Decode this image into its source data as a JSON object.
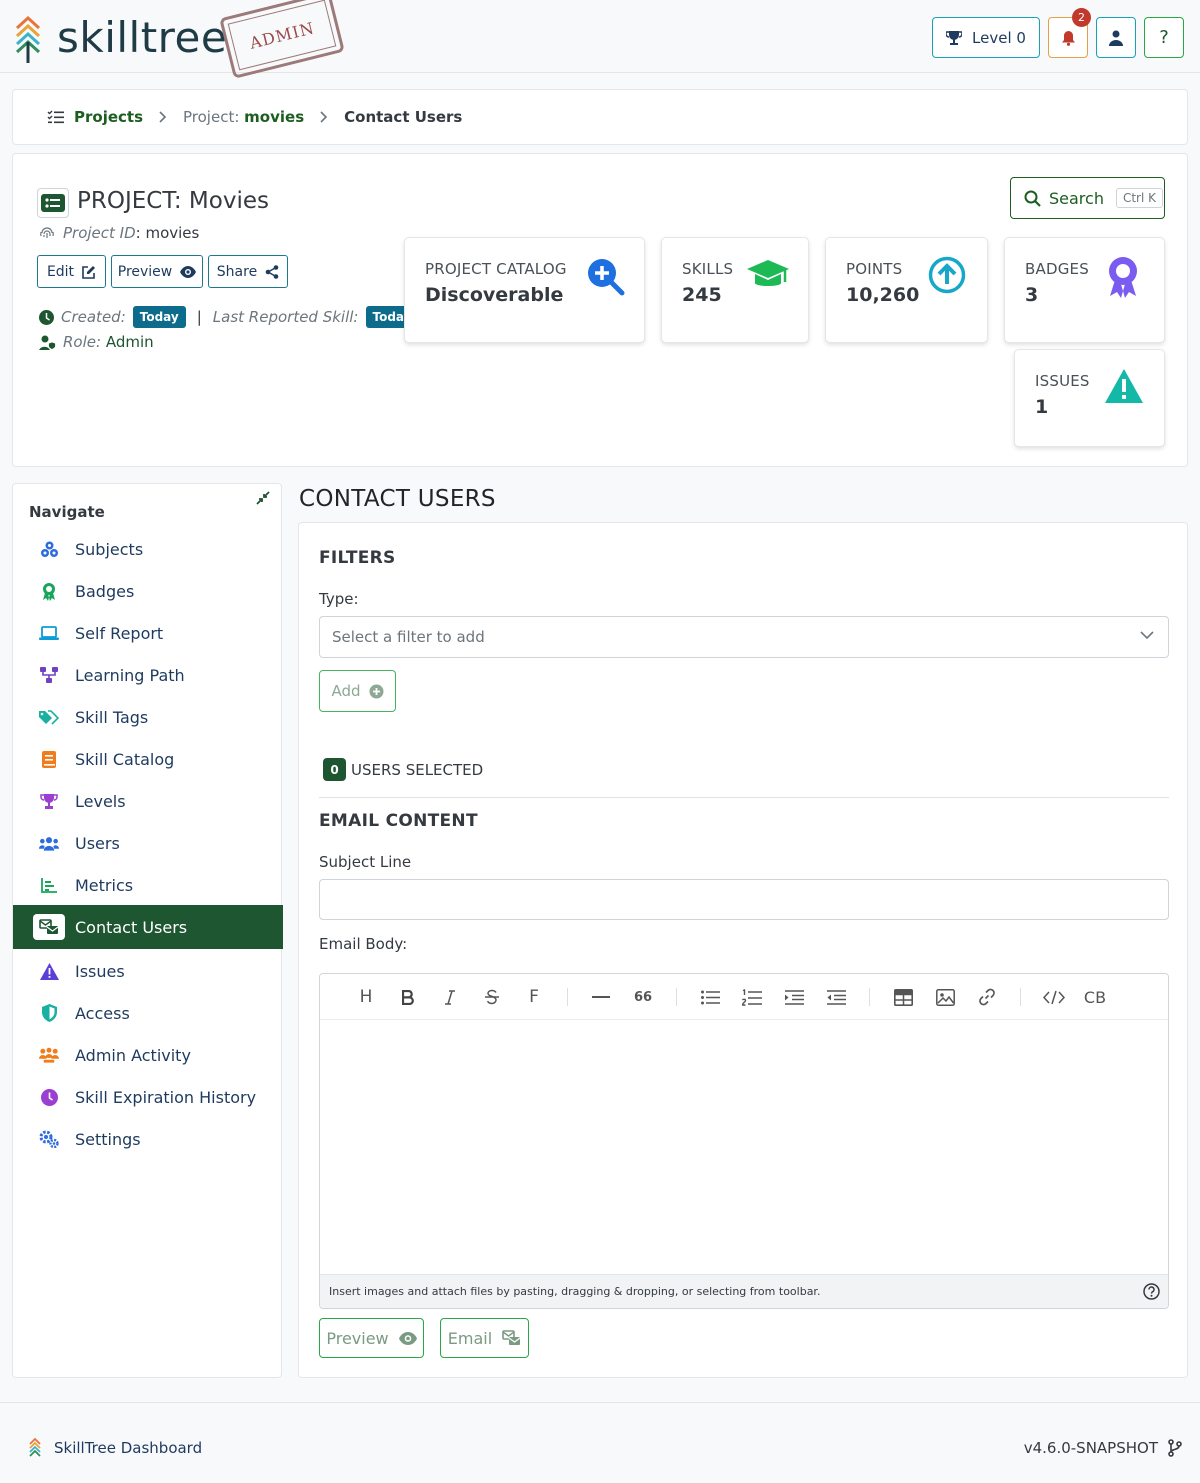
{
  "app": {
    "brand": "skilltree",
    "stamp": "ADMIN"
  },
  "topbar": {
    "level_label": "Level 0",
    "notification_count": "2",
    "help_label": "?"
  },
  "breadcrumb": {
    "projects": "Projects",
    "project_prefix": "Project:",
    "project_name": "movies",
    "current": "Contact Users"
  },
  "project": {
    "title": "PROJECT: Movies",
    "id_label": "Project ID",
    "id_value": ": movies",
    "buttons": {
      "edit": "Edit",
      "preview": "Preview",
      "share": "Share"
    },
    "created_label": "Created:",
    "created_value": "Today",
    "last_reported_label": "Last Reported Skill:",
    "last_reported_value": "Today",
    "separator": "|",
    "role_label": "Role:",
    "role_value": "Admin",
    "search_label": "Search",
    "search_kbd": "Ctrl K"
  },
  "stats": {
    "catalog": {
      "label": "PROJECT CATALOG",
      "value": "Discoverable"
    },
    "skills": {
      "label": "SKILLS",
      "value": "245"
    },
    "points": {
      "label": "POINTS",
      "value": "10,260"
    },
    "badges": {
      "label": "BADGES",
      "value": "3"
    },
    "issues": {
      "label": "ISSUES",
      "value": "1"
    }
  },
  "nav": {
    "title": "Navigate",
    "items": [
      {
        "label": "Subjects",
        "icon": "cubes-icon"
      },
      {
        "label": "Badges",
        "icon": "award-icon"
      },
      {
        "label": "Self Report",
        "icon": "laptop-icon"
      },
      {
        "label": "Learning Path",
        "icon": "network-icon"
      },
      {
        "label": "Skill Tags",
        "icon": "tags-icon"
      },
      {
        "label": "Skill Catalog",
        "icon": "book-icon"
      },
      {
        "label": "Levels",
        "icon": "trophy-icon"
      },
      {
        "label": "Users",
        "icon": "users-icon"
      },
      {
        "label": "Metrics",
        "icon": "chart-icon"
      },
      {
        "label": "Contact Users",
        "icon": "mail-bulk-icon"
      },
      {
        "label": "Issues",
        "icon": "warning-icon"
      },
      {
        "label": "Access",
        "icon": "shield-icon"
      },
      {
        "label": "Admin Activity",
        "icon": "activity-icon"
      },
      {
        "label": "Skill Expiration History",
        "icon": "clock-icon"
      },
      {
        "label": "Settings",
        "icon": "cogs-icon"
      }
    ]
  },
  "main": {
    "title": "CONTACT USERS",
    "filters_title": "FILTERS",
    "type_label": "Type:",
    "type_placeholder": "Select a filter to add",
    "add_label": "Add",
    "selected_count": "0",
    "selected_label": "USERS SELECTED",
    "email_title": "EMAIL CONTENT",
    "subject_label": "Subject Line",
    "subject_value": "",
    "body_label": "Email Body:",
    "editor_hint": "Insert images and attach files by pasting, dragging & dropping, or selecting from toolbar.",
    "toolbar": {
      "heading": "H",
      "font": "F",
      "quote": "66",
      "cb": "CB"
    },
    "preview_label": "Preview",
    "email_label": "Email"
  },
  "footer": {
    "name": "SkillTree Dashboard",
    "version": "v4.6.0-SNAPSHOT"
  },
  "colors": {
    "primary_green": "#1e5631",
    "teal": "#17a2b8",
    "badge_red": "#c0392b",
    "today_blue": "#0d6c8c"
  }
}
